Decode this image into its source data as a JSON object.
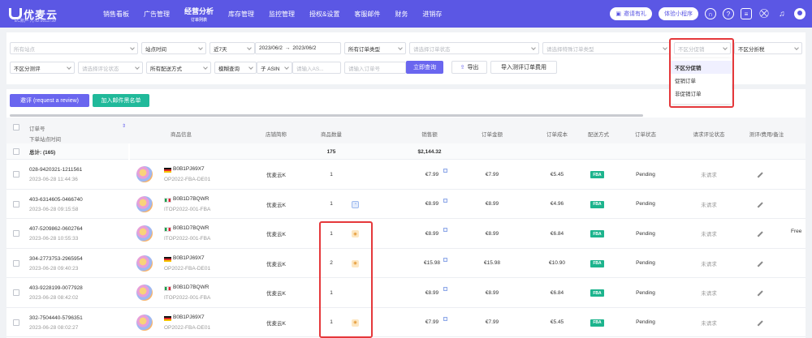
{
  "app": {
    "logo_text": "优麦云",
    "account": "EC账户·九·ID:5011739"
  },
  "nav": {
    "items": [
      {
        "label": "销售看板",
        "sub": ""
      },
      {
        "label": "广告管理",
        "sub": ""
      },
      {
        "label": "经营分析",
        "sub": "订单列表",
        "active": true
      },
      {
        "label": "库存管理",
        "sub": ""
      },
      {
        "label": "监控管理",
        "sub": ""
      },
      {
        "label": "授权&设置",
        "sub": ""
      },
      {
        "label": "客服邮件",
        "sub": ""
      },
      {
        "label": "财务",
        "sub": ""
      },
      {
        "label": "进销存",
        "sub": ""
      }
    ],
    "invite_label": "邀请有礼",
    "miniprogram_label": "体验小程序",
    "icons": [
      "headset-icon",
      "help-icon",
      "message-icon",
      "cart-icon",
      "bell-icon",
      "avatar"
    ]
  },
  "filters": {
    "row1": {
      "shop_placeholder": "所有站点",
      "time_type": "站点时间",
      "range_preset": "近7天",
      "date_start": "2023/06/2",
      "date_arrow": "→",
      "date_end": "2023/06/2",
      "order_type": "所有订单类型",
      "order_status_placeholder": "请选择订单状态",
      "special_order_placeholder": "请选择特殊订单类型",
      "promo_placeholder": "不区分促销",
      "discount": "不区分折税"
    },
    "row2": {
      "review_filter": "不区分测评",
      "review_status_placeholder": "请选择评论状态",
      "ship_method": "所有配送方式",
      "fuzzy_query": "模糊查询",
      "asin_type": "子 ASIN",
      "asin_placeholder": "请输入AS...",
      "order_placeholder": "请输入订单号",
      "search_button": "立即查询",
      "export_button": "导出",
      "import_button": "导入测评订单费用"
    },
    "promo_dropdown": {
      "options": [
        "不区分促销",
        "促销订单",
        "非促销订单"
      ],
      "selected": "不区分促销"
    }
  },
  "actions": {
    "review_request": "邀评 (request a review)",
    "add_mail_blacklist": "加入邮件黑名单"
  },
  "table": {
    "headers": {
      "order_no": "订单号",
      "order_time": "下单站点时间",
      "product_info": "商品信息",
      "shop": "店铺简称",
      "qty": "商品数量",
      "sales": "销售额",
      "order_amount": "订单金额",
      "order_cost": "订单成本",
      "ship": "配送方式",
      "status": "订单状态",
      "review_status": "请求评论状态",
      "review_fee": "测评/费用/备注"
    },
    "total": {
      "label": "总计: (165)",
      "qty": "175",
      "sales": "$2,144.32"
    },
    "rows": [
      {
        "order_id": "028-9420321-1211561",
        "time": "2023-06-28 11:44:36",
        "flag": "de",
        "asin": "B0B1PJ69X7",
        "sku": "OP2022-FBA-DE01",
        "shop": "优麦云K",
        "qty": "1",
        "qty_icon": "",
        "sales": "€7.99",
        "amount": "€7.99",
        "cost": "€5.45",
        "ship": "FBA",
        "status": "Pending",
        "review": "未请求"
      },
      {
        "order_id": "403-6314605-0466740",
        "time": "2023-06-28 09:15:58",
        "flag": "it",
        "asin": "B0B1D7BQWR",
        "sku": "ITOP2022-001-FBA",
        "shop": "优麦云K",
        "qty": "1",
        "qty_icon": "blue",
        "sales": "€8.99",
        "amount": "€8.99",
        "cost": "€4.96",
        "ship": "FBA",
        "status": "Pending",
        "review": "未请求"
      },
      {
        "order_id": "407-5209862-0602764",
        "time": "2023-06-28 10:55:33",
        "flag": "it",
        "asin": "B0B1D7BQWR",
        "sku": "ITOP2022-001-FBA",
        "shop": "优麦云K",
        "qty": "1",
        "qty_icon": "orange",
        "sales": "€8.99",
        "amount": "€8.99",
        "cost": "€6.84",
        "ship": "FBA",
        "status": "Pending",
        "review": "未请求"
      },
      {
        "order_id": "304-2773753-2965954",
        "time": "2023-06-28 09:40:23",
        "flag": "de",
        "asin": "B0B1PJ69X7",
        "sku": "OP2022-FBA-DE01",
        "shop": "优麦云K",
        "qty": "2",
        "qty_icon": "orange",
        "sales": "€15.98",
        "amount": "€15.98",
        "cost": "€10.90",
        "ship": "FBA",
        "status": "Pending",
        "review": "未请求"
      },
      {
        "order_id": "403-9228199-0077928",
        "time": "2023-06-28 08:42:02",
        "flag": "it",
        "asin": "B0B1D7BQWR",
        "sku": "ITOP2022-001-FBA",
        "shop": "优麦云K",
        "qty": "1",
        "qty_icon": "",
        "sales": "€8.99",
        "amount": "€8.99",
        "cost": "€6.84",
        "ship": "FBA",
        "status": "Pending",
        "review": "未请求"
      },
      {
        "order_id": "302-7504440-5796351",
        "time": "2023-06-28 08:02:27",
        "flag": "de",
        "asin": "B0B1PJ69X7",
        "sku": "OP2022-FBA-DE01",
        "shop": "优麦云K",
        "qty": "1",
        "qty_icon": "orange",
        "sales": "€7.99",
        "amount": "€7.99",
        "cost": "€5.45",
        "ship": "FBA",
        "status": "Pending",
        "review": "未请求"
      }
    ],
    "overflow_text": "Free"
  },
  "colors": {
    "brand": "#5b57e4",
    "primary_button": "#6a66ef",
    "success_button": "#20b99a",
    "highlight_box": "#e5383b",
    "fba_badge": "#1db48d"
  }
}
